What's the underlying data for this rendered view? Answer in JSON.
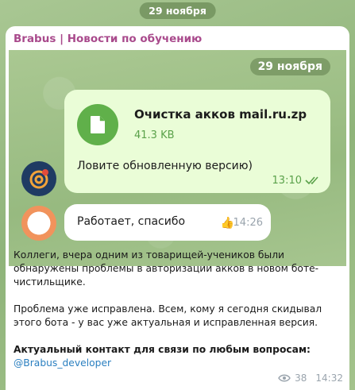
{
  "chat": {
    "date": "29 ноября"
  },
  "post": {
    "channel": "Brabus | Новости по обучению",
    "screenshot": {
      "date": "29 ноября",
      "file": {
        "name": "Очистка акков mail.ru.zp",
        "size": "41.3 KB",
        "caption": "Ловите обновленную версию)",
        "time": "13:10"
      },
      "reply": {
        "text": "Работает, спасибо",
        "time": "14:26"
      }
    },
    "paragraph1": "Коллеги, вчера одним из товарищей-учеников были обнаружены проблемы в авторизации акков в новом боте-чистильщике.",
    "paragraph2": "Проблема уже исправлена. Всем, кому я сегодня скидывал этого бота - у вас уже актуальная и исправленная версия.",
    "contact_title": "Актуальный контакт для связи по любым вопросам:",
    "contact_link": "@Brabus_developer",
    "views": "38",
    "time": "14:32"
  },
  "colors": {
    "channel_name": "#a94a8c",
    "link": "#2a7fc0",
    "file_icon": "#60b04a"
  },
  "icons": {
    "file": "file-icon",
    "checks": "double-check-icon",
    "like": "thumbs-up-icon",
    "views": "eye-icon"
  }
}
